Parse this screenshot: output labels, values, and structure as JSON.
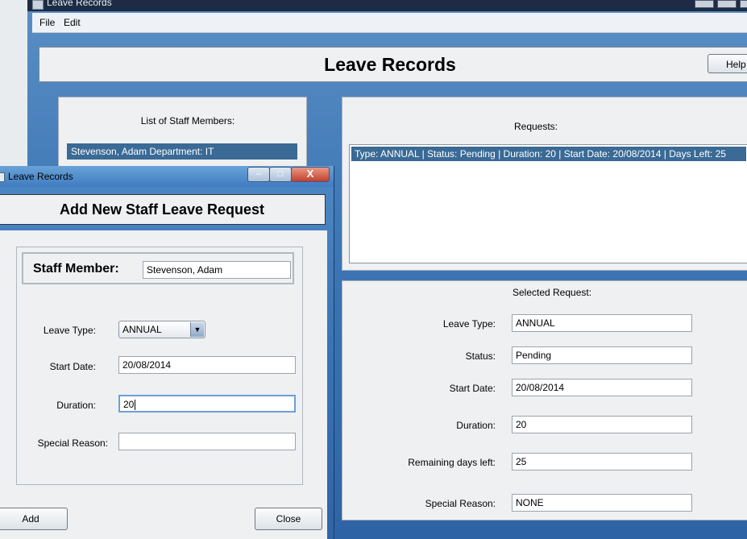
{
  "main_window": {
    "title": "Leave Records",
    "menu": [
      "File",
      "Edit"
    ],
    "header_title": "Leave Records",
    "help_label": "Help",
    "staff_panel": {
      "label": "List of Staff Members:",
      "items": [
        "Stevenson, Adam Department:  IT"
      ]
    },
    "requests_panel": {
      "label": "Requests:",
      "items": [
        "Type: ANNUAL | Status: Pending | Duration: 20 | Start Date: 20/08/2014 | Days Left: 25"
      ]
    },
    "selected_panel": {
      "label": "Selected Request:",
      "fields": [
        {
          "label": "Leave Type:",
          "value": "ANNUAL"
        },
        {
          "label": "Status:",
          "value": "Pending"
        },
        {
          "label": "Start Date:",
          "value": "20/08/2014"
        },
        {
          "label": "Duration:",
          "value": "20"
        },
        {
          "label": "Remaining days left:",
          "value": "25"
        },
        {
          "label": "Special Reason:",
          "value": "NONE"
        }
      ]
    }
  },
  "dialog": {
    "title": "Leave Records",
    "controls": {
      "minimize": "–",
      "maximize": "□",
      "close": "X"
    },
    "header_title": "Add New Staff Leave Request",
    "staff_member_label": "Staff Member:",
    "staff_member_value": "Stevenson, Adam",
    "leave_type_label": "Leave Type:",
    "leave_type_value": "ANNUAL",
    "start_date_label": "Start Date:",
    "start_date_value": "20/08/2014",
    "duration_label": "Duration:",
    "duration_value": "20",
    "special_reason_label": "Special Reason:",
    "special_reason_value": "",
    "add_label": "Add",
    "close_label": "Close"
  }
}
